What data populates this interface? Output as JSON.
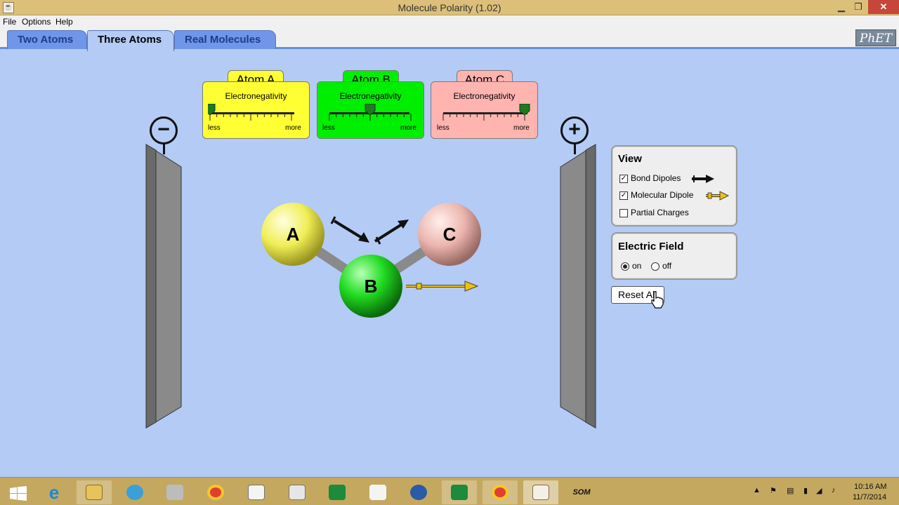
{
  "window": {
    "title": "Molecule Polarity (1.02)"
  },
  "menu": {
    "file": "File",
    "options": "Options",
    "help": "Help"
  },
  "tabs": [
    {
      "label": "Two Atoms",
      "active": false
    },
    {
      "label": "Three Atoms",
      "active": true
    },
    {
      "label": "Real Molecules",
      "active": false
    }
  ],
  "logo": "PhET",
  "plates": {
    "negative_symbol": "⊖",
    "positive_symbol": "⊕"
  },
  "atoms": [
    {
      "tab": "Atom A",
      "label": "Electronegativity",
      "less": "less",
      "more": "more",
      "color": "#ffff33",
      "electronegativity_level": 0.0
    },
    {
      "tab": "Atom B",
      "label": "Electronegativity",
      "less": "less",
      "more": "more",
      "color": "#00ee00",
      "electronegativity_level": 0.5
    },
    {
      "tab": "Atom C",
      "label": "Electronegativity",
      "less": "less",
      "more": "more",
      "color": "#ffb4b0",
      "electronegativity_level": 1.0
    }
  ],
  "molecule": {
    "atom_a": "A",
    "atom_b": "B",
    "atom_c": "C"
  },
  "view_panel": {
    "title": "View",
    "bond_dipoles": {
      "label": "Bond Dipoles",
      "checked": true
    },
    "molecular_dipole": {
      "label": "Molecular Dipole",
      "checked": true
    },
    "partial_charges": {
      "label": "Partial Charges",
      "checked": false
    }
  },
  "field_panel": {
    "title": "Electric Field",
    "on_label": "on",
    "off_label": "off",
    "selected": "on"
  },
  "reset_button": "Reset All",
  "taskbar": {
    "time": "10:16 AM",
    "date": "11/7/2014",
    "apps": [
      "start-icon",
      "internet-explorer-icon",
      "file-explorer-icon",
      "picasa-icon",
      "app-icon",
      "chrome-icon",
      "chart-app-icon",
      "notepad-icon",
      "excel-icon",
      "apps-grid-icon",
      "media-icon",
      "excel-icon",
      "chrome-icon",
      "java-icon",
      "som-icon"
    ],
    "som_label": "SOM"
  }
}
